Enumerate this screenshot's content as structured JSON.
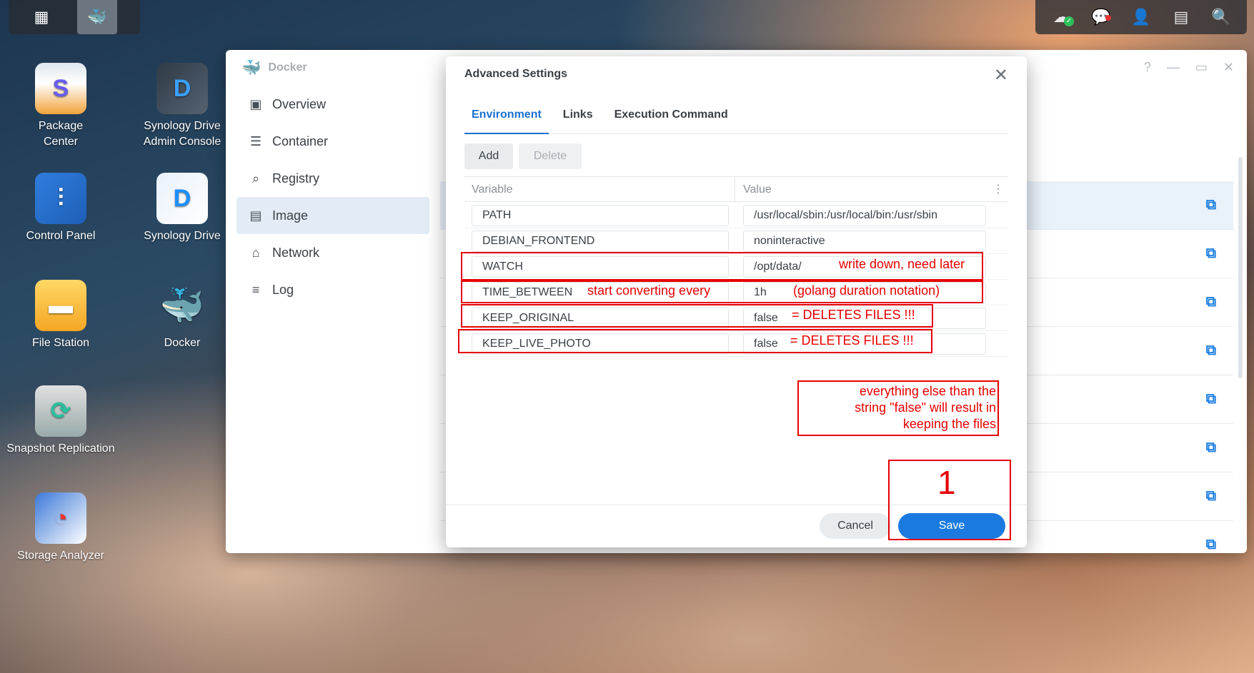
{
  "taskbar": {
    "left_icons": [
      "main-menu-icon",
      "docker-icon"
    ],
    "right_icons": [
      "cloud-sync-icon",
      "chat-icon",
      "user-icon",
      "widgets-icon",
      "search-icon"
    ]
  },
  "desktop": {
    "icons": [
      {
        "label_line1": "Package",
        "label_line2": "Center"
      },
      {
        "label_line1": "Synology Drive",
        "label_line2": "Admin Console"
      },
      {
        "label_line1": "Control Panel",
        "label_line2": ""
      },
      {
        "label_line1": "Synology Drive",
        "label_line2": ""
      },
      {
        "label_line1": "File Station",
        "label_line2": ""
      },
      {
        "label_line1": "Docker",
        "label_line2": ""
      },
      {
        "label_line1": "Snapshot Replication",
        "label_line2": ""
      },
      {
        "label_line1": "Storage Analyzer",
        "label_line2": ""
      }
    ]
  },
  "docker_window": {
    "title": "Docker",
    "controls": [
      "?",
      "—",
      "▭",
      "✕"
    ],
    "nav": [
      {
        "label": "Overview"
      },
      {
        "label": "Container"
      },
      {
        "label": "Registry"
      },
      {
        "label": "Image"
      },
      {
        "label": "Network"
      },
      {
        "label": "Log"
      }
    ]
  },
  "dialog": {
    "title": "Advanced Settings",
    "tabs": [
      "Environment",
      "Links",
      "Execution Command"
    ],
    "add_label": "Add",
    "delete_label": "Delete",
    "col_variable": "Variable",
    "col_value": "Value",
    "rows": [
      {
        "variable": "PATH",
        "value": "/usr/local/sbin:/usr/local/bin:/usr/sbin"
      },
      {
        "variable": "DEBIAN_FRONTEND",
        "value": "noninteractive"
      },
      {
        "variable": "WATCH",
        "value": "/opt/data/"
      },
      {
        "variable": "TIME_BETWEEN",
        "value": "1h"
      },
      {
        "variable": "KEEP_ORIGINAL",
        "value": "false"
      },
      {
        "variable": "KEEP_LIVE_PHOTO",
        "value": "false"
      }
    ],
    "cancel_label": "Cancel",
    "save_label": "Save"
  },
  "annotations": {
    "watch": "write down, need later",
    "time_between_var": "start converting every",
    "time_between_val": "(golang duration notation)",
    "keep_original": "= DELETES FILES !!!",
    "keep_live_photo": "= DELETES FILES !!!",
    "note_line1": "everything else than the",
    "note_line2": "string \"false\" will result in",
    "note_line3": "keeping the files",
    "step": "1",
    "color": "#e60000"
  }
}
